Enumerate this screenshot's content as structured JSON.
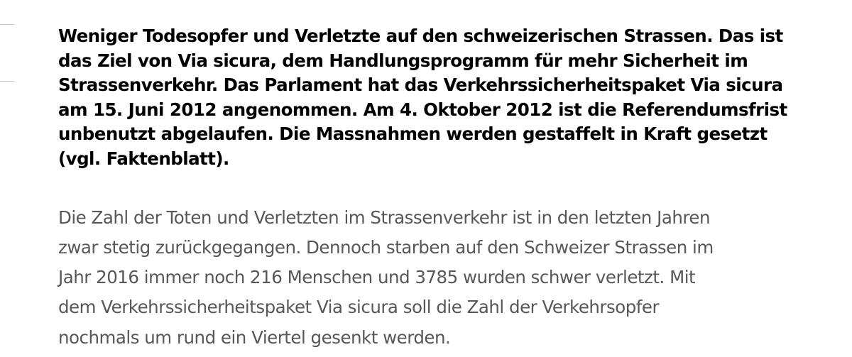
{
  "article": {
    "lead": "Weniger Todesopfer und Verletzte auf den schweizerischen Strassen. Das ist\ndas Ziel von Via sicura, dem Handlungsprogramm für mehr Sicherheit im\nStrassenverkehr. Das Parlament hat das Verkehrssicherheitspaket Via sicura\nam 15. Juni 2012 angenommen. Am 4. Oktober 2012 ist die Referendumsfrist\nunbenutzt abgelaufen. Die Massnahmen werden gestaffelt in Kraft gesetzt\n(vgl. Faktenblatt).",
    "body": "Die Zahl der Toten und Verletzten im Strassenverkehr ist in den letzten Jahren\nzwar stetig zurückgegangen. Dennoch starben auf den Schweizer Strassen im\nJahr 2016 immer noch 216 Menschen und 3785 wurden schwer verletzt. Mit\ndem Verkehrssicherheitspaket Via sicura soll die Zahl der Verkehrsopfer\nnochmals um rund ein Viertel gesenkt werden."
  },
  "colors": {
    "lead_text": "#000000",
    "body_text": "#575757",
    "side_rule": "#c9c9c9"
  }
}
